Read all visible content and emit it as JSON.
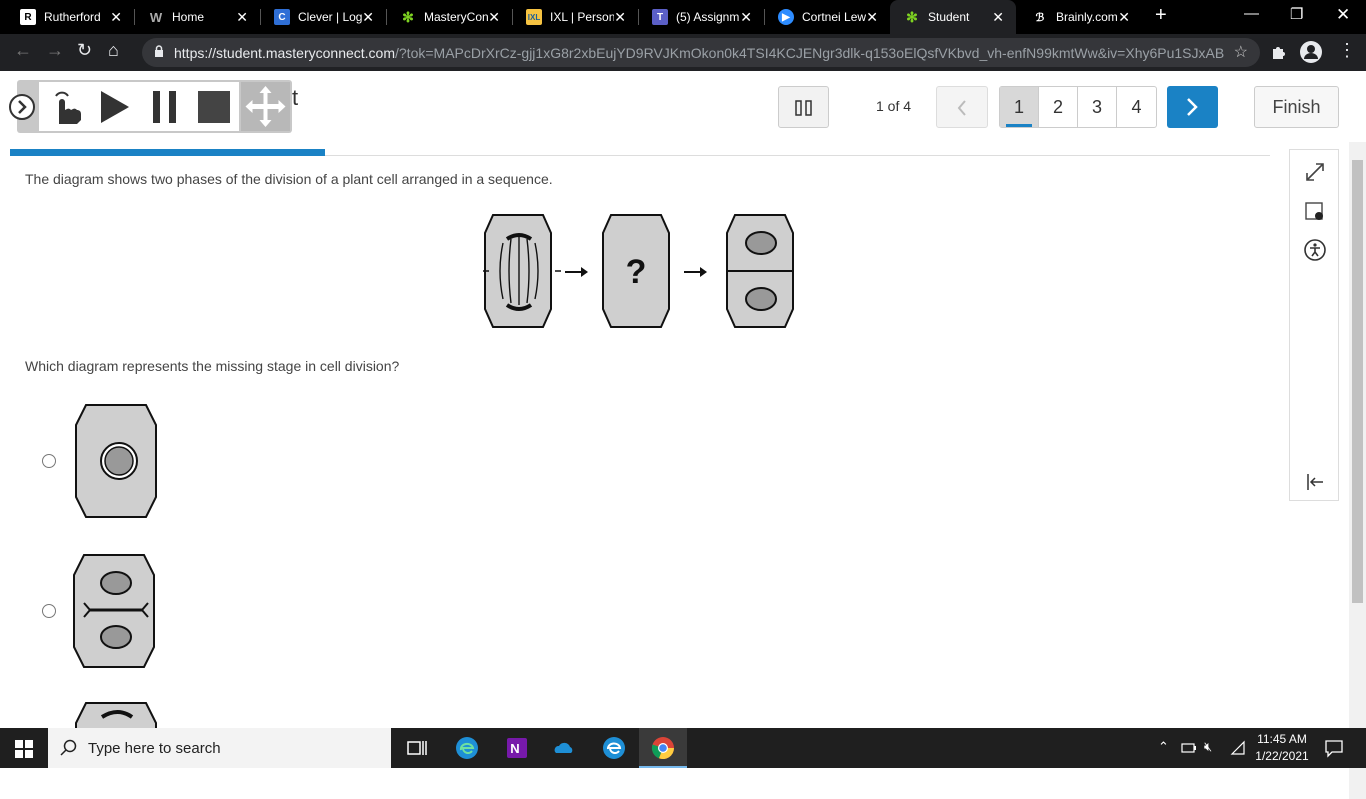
{
  "browser": {
    "tabs": [
      {
        "title": "Rutherford",
        "icon": "rutherford-icon",
        "active": false
      },
      {
        "title": "Home",
        "icon": "wp-icon",
        "active": false
      },
      {
        "title": "Clever | Log",
        "icon": "clever-icon",
        "active": false
      },
      {
        "title": "MasteryCon",
        "icon": "masteryconnect-icon",
        "active": false
      },
      {
        "title": "IXL | Person",
        "icon": "ixl-icon",
        "active": false
      },
      {
        "title": "(5) Assignm",
        "icon": "teams-icon",
        "active": false
      },
      {
        "title": "Cortnei Lew",
        "icon": "zoom-icon",
        "active": false
      },
      {
        "title": "Student",
        "icon": "masteryconnect-icon",
        "active": true
      },
      {
        "title": "Brainly.com",
        "icon": "brainly-icon",
        "active": false
      }
    ],
    "url_host": "https://student.masteryconnect.com",
    "url_rest": "/?tok=MAPcDrXrCz-gjj1xG8r2xbEujYD9RVJKmOkon0k4TSI4KCJENgr3dlk-q153oElQsfVKbvd_vh-enfN99kmtWw&iv=Xhy6Pu1SJxABQ..."
  },
  "assessment": {
    "title_fragment": "t",
    "pager_label": "1 of 4",
    "pages": [
      "1",
      "2",
      "3",
      "4"
    ],
    "current_page": "1",
    "finish_label": "Finish",
    "progress_fraction": 0.25,
    "accent_color": "#1a82c5"
  },
  "question": {
    "stem": "The diagram shows two phases of the division of a plant cell arranged in a sequence.",
    "missing_marker": "?",
    "prompt": "Which diagram represents the missing stage in cell division?"
  },
  "taskbar": {
    "search_placeholder": "Type here to search",
    "time": "11:45 AM",
    "date": "1/22/2021"
  }
}
